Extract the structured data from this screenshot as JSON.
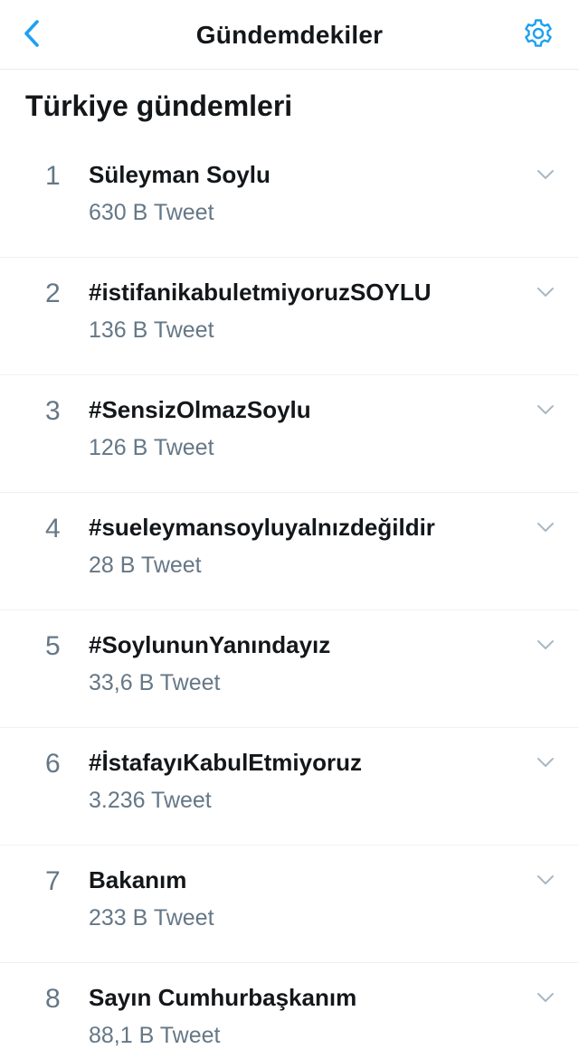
{
  "nav": {
    "title": "Gündemdekiler",
    "back_icon": "chevron-left-icon",
    "settings_icon": "gear-icon",
    "accent_color": "#1da1f2"
  },
  "section": {
    "title": "Türkiye gündemleri"
  },
  "trends": [
    {
      "rank": "1",
      "name": "Süleyman Soylu",
      "count": "630 B Tweet"
    },
    {
      "rank": "2",
      "name": "#istifanikabuletmiyoruzSOYLU",
      "count": "136 B Tweet"
    },
    {
      "rank": "3",
      "name": "#SensizOlmazSoylu",
      "count": "126 B Tweet"
    },
    {
      "rank": "4",
      "name": "#sueleymansoyluyalnızdeğildir",
      "count": "28 B Tweet"
    },
    {
      "rank": "5",
      "name": "#SoylununYanındayız",
      "count": "33,6 B Tweet"
    },
    {
      "rank": "6",
      "name": "#İstafayıKabulEtmiyoruz",
      "count": "3.236 Tweet"
    },
    {
      "rank": "7",
      "name": "Bakanım",
      "count": "233 B Tweet"
    },
    {
      "rank": "8",
      "name": "Sayın Cumhurbaşkanım",
      "count": "88,1 B Tweet"
    }
  ],
  "colors": {
    "text_primary": "#14171a",
    "text_secondary": "#657786",
    "divider": "#e6ecf0",
    "chevron": "#aab8c2"
  }
}
